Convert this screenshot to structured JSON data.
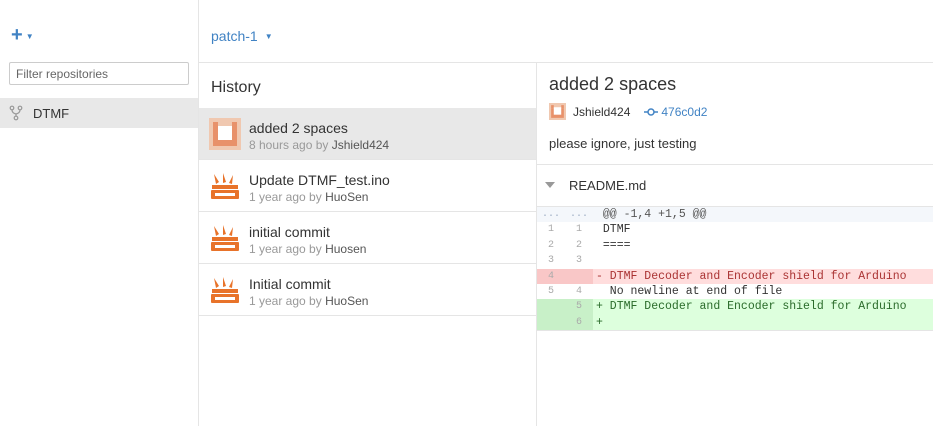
{
  "sidebar": {
    "add_icon": "plus-icon",
    "filter_placeholder": "Filter repositories",
    "repos": [
      {
        "name": "DTMF",
        "icon": "repo-fork-icon"
      }
    ]
  },
  "branch": {
    "name": "patch-1",
    "icon": "caret-down-icon"
  },
  "history": {
    "title": "History",
    "commits": [
      {
        "title": "added 2 spaces",
        "when": "8 hours ago by ",
        "author": "Jshield424",
        "selected": true,
        "avatar": "identicon"
      },
      {
        "title": "Update DTMF_test.ino",
        "when": "1 year ago by ",
        "author": "HuoSen",
        "selected": false,
        "avatar": "seeed-avatar"
      },
      {
        "title": "initial commit",
        "when": "1 year ago by ",
        "author": "Huosen",
        "selected": false,
        "avatar": "seeed-avatar"
      },
      {
        "title": "Initial commit",
        "when": "1 year ago by ",
        "author": "HuoSen",
        "selected": false,
        "avatar": "seeed-avatar"
      }
    ]
  },
  "detail": {
    "title": "added 2 spaces",
    "author": "Jshield424",
    "sha": "476c0d2",
    "message": "please ignore, just testing",
    "file": {
      "name": "README.md",
      "rows": [
        {
          "type": "hunk",
          "old": "...",
          "new": "...",
          "code": " @@ -1,4 +1,5 @@"
        },
        {
          "type": "ctx",
          "old": "1",
          "new": "1",
          "code": " DTMF"
        },
        {
          "type": "ctx",
          "old": "2",
          "new": "2",
          "code": " ===="
        },
        {
          "type": "ctx",
          "old": "3",
          "new": "3",
          "code": ""
        },
        {
          "type": "del",
          "old": "4",
          "new": "",
          "code": "- DTMF Decoder and Encoder shield for Arduino"
        },
        {
          "type": "ctx",
          "old": "5",
          "new": "4",
          "code": "  No newline at end of file"
        },
        {
          "type": "add",
          "old": "",
          "new": "5",
          "code": "+ DTMF Decoder and Encoder shield for Arduino"
        },
        {
          "type": "add",
          "old": "",
          "new": "6",
          "code": "+"
        }
      ]
    }
  },
  "colors": {
    "accent": "#4183c4",
    "selected_bg": "#e8e8e8",
    "del_bg": "#ffdddd",
    "add_bg": "#ddffdd"
  }
}
